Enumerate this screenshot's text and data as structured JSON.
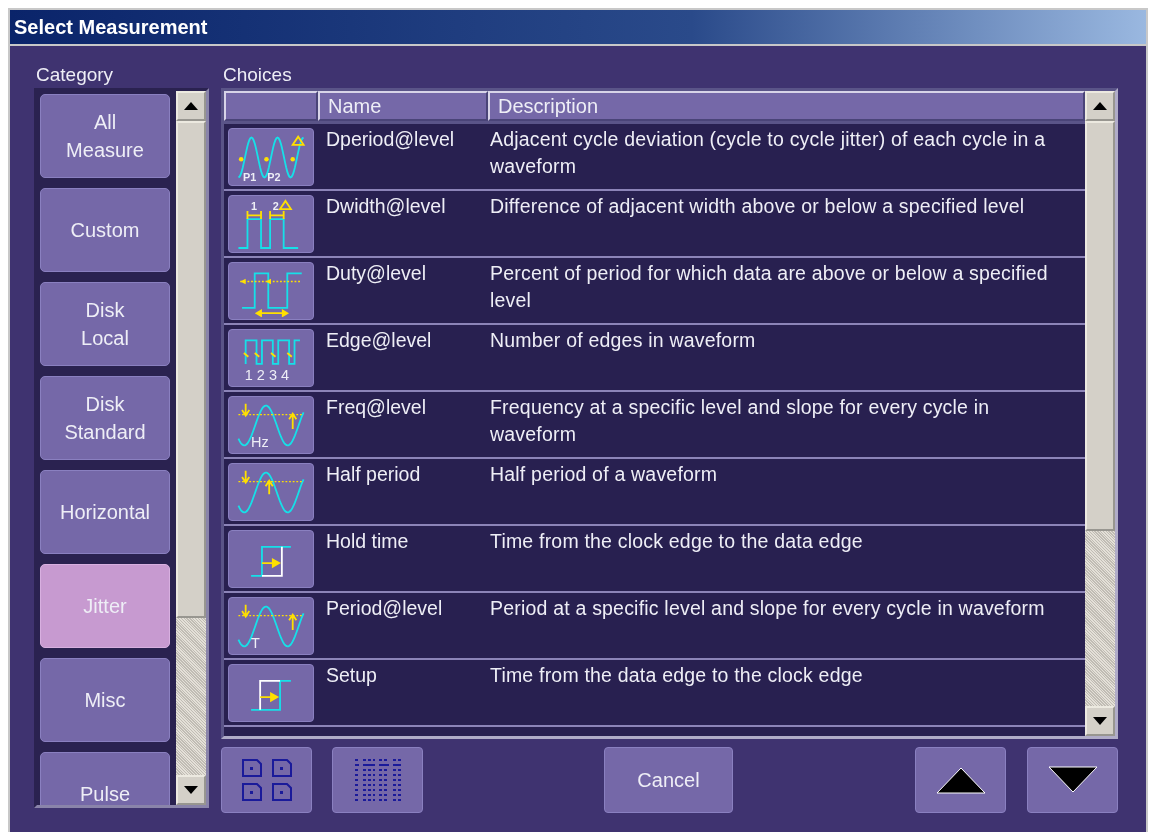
{
  "window": {
    "title": "Select Measurement"
  },
  "category": {
    "label": "Category",
    "items": [
      {
        "label": "All\nMeasure",
        "selected": false
      },
      {
        "label": "Custom",
        "selected": false
      },
      {
        "label": "Disk\nLocal",
        "selected": false
      },
      {
        "label": "Disk\nStandard",
        "selected": false
      },
      {
        "label": "Horizontal",
        "selected": false
      },
      {
        "label": "Jitter",
        "selected": true
      },
      {
        "label": "Misc",
        "selected": false
      },
      {
        "label": "Pulse",
        "selected": false
      }
    ]
  },
  "choices": {
    "label": "Choices",
    "columns": [
      "Name",
      "Description"
    ],
    "rows": [
      {
        "kind": "dperiod",
        "icon_text": [
          "P1",
          "P2"
        ],
        "name": "Dperiod@level",
        "description": "Adjacent cycle deviation (cycle to cycle jitter) of each cycle in a waveform"
      },
      {
        "kind": "dwidth",
        "icon_text": [
          "1",
          "2"
        ],
        "name": "Dwidth@level",
        "description": "Difference of adjacent width above or below a specified level"
      },
      {
        "kind": "duty",
        "name": "Duty@level",
        "description": "Percent of period for which data are above or below a specified level"
      },
      {
        "kind": "edge",
        "icon_text": [
          "1 2 3 4"
        ],
        "name": "Edge@level",
        "description": "Number of edges in waveform"
      },
      {
        "kind": "freq",
        "icon_text": [
          "Hz"
        ],
        "name": "Freq@level",
        "description": "Frequency at a specific level and slope for every cycle in waveform"
      },
      {
        "kind": "half",
        "name": "Half period",
        "description": "Half period of a waveform"
      },
      {
        "kind": "hold",
        "name": "Hold time",
        "description": "Time from the clock edge to the data edge"
      },
      {
        "kind": "period",
        "icon_text": [
          "T"
        ],
        "name": "Period@level",
        "description": "Period at a specific level and slope for every cycle in waveform"
      },
      {
        "kind": "setup",
        "name": "Setup",
        "description": "Time from the data edge to the clock edge"
      }
    ]
  },
  "buttons": [
    {
      "kind": "grid"
    },
    {
      "kind": "list"
    },
    {
      "kind": "text",
      "label": "Cancel"
    },
    {
      "kind": "up"
    },
    {
      "kind": "down"
    }
  ]
}
